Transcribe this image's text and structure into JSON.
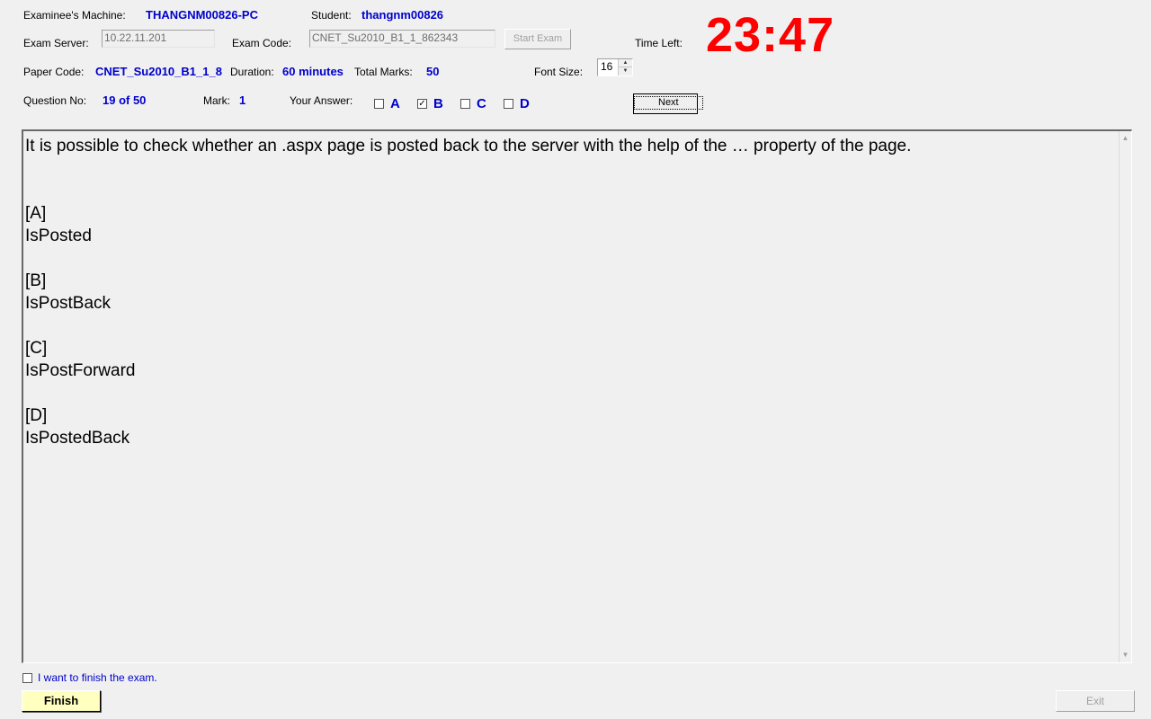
{
  "header": {
    "machine_label": "Examinee's Machine:",
    "machine_value": "THANGNM00826-PC",
    "student_label": "Student:",
    "student_value": "thangnm00826",
    "server_label": "Exam Server:",
    "server_value": "10.22.11.201",
    "exam_code_label": "Exam Code:",
    "exam_code_value": "CNET_Su2010_B1_1_862343",
    "start_exam_label": "Start Exam",
    "time_left_label": "Time Left:",
    "time_left_value": "23:47",
    "paper_code_label": "Paper Code:",
    "paper_code_value": "CNET_Su2010_B1_1_8",
    "duration_label": "Duration:",
    "duration_value": "60 minutes",
    "total_marks_label": "Total Marks:",
    "total_marks_value": "50",
    "font_size_label": "Font Size:",
    "font_size_value": "16",
    "question_no_label": "Question No:",
    "question_no_value": "19 of 50",
    "mark_label": "Mark:",
    "mark_value": "1",
    "your_answer_label": "Your Answer:",
    "next_label": "Next"
  },
  "answers": [
    {
      "letter": "A",
      "checked": false
    },
    {
      "letter": "B",
      "checked": true
    },
    {
      "letter": "C",
      "checked": false
    },
    {
      "letter": "D",
      "checked": false
    }
  ],
  "question": {
    "text": "It is possible to check whether an .aspx page is posted back to the server with the help of the … property of the page.\n\n\n[A]\nIsPosted\n\n[B]\nIsPostBack\n\n[C]\nIsPostForward\n\n[D]\nIsPostedBack"
  },
  "footer": {
    "finish_checkbox_label": "I want to finish the exam.",
    "finish_label": "Finish",
    "exit_label": "Exit"
  },
  "colors": {
    "value_blue": "#0000cc",
    "timer_red": "#ff0000",
    "finish_bg": "#ffffc0"
  }
}
